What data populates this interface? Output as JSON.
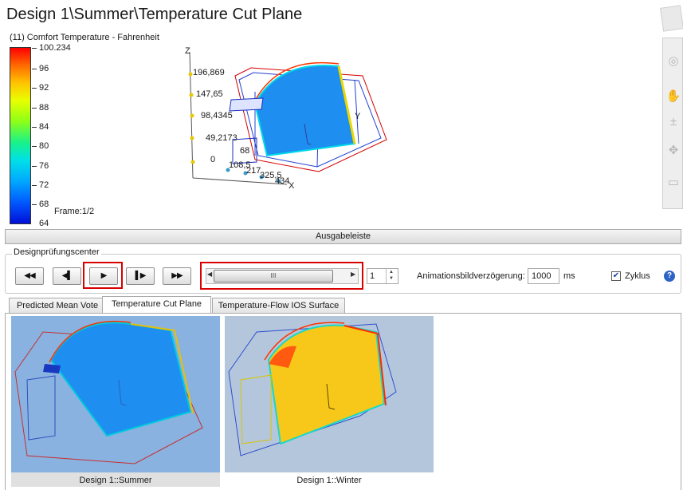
{
  "window": {
    "title": "Design 1\\Summer\\Temperature Cut Plane"
  },
  "legend": {
    "title": "(11) Comfort Temperature - Fahrenheit",
    "ticks": [
      "100.234",
      "96",
      "92",
      "88",
      "84",
      "80",
      "76",
      "72",
      "68",
      "64"
    ],
    "frame": "Frame:1/2"
  },
  "view3d": {
    "axis_z": "Z",
    "axis_y": "Y",
    "axis_x": "X",
    "z_ticks": [
      "196,869",
      "147,65",
      "98,4345",
      "49,2173",
      "0"
    ],
    "x_ticks": [
      "108,5",
      "217",
      "325,5",
      "434"
    ],
    "small_label": "68"
  },
  "output_bar": {
    "label": "Ausgabeleiste"
  },
  "design_center": {
    "label": "Designprüfungscenter",
    "buttons": {
      "first": "◀◀",
      "prev": "◀▌",
      "play": "▶",
      "next": "▌▶",
      "last": "▶▶"
    },
    "scroll_grip": "III",
    "frame_value": "1",
    "delay_label": "Animationsbildverzögerung:",
    "delay_value": "1000",
    "delay_unit": "ms",
    "cycle_label": "Zyklus",
    "cycle_checked": true,
    "help": "?"
  },
  "tabs": [
    {
      "label": "Predicted Mean Vote",
      "active": false
    },
    {
      "label": "Temperature Cut Plane",
      "active": true
    },
    {
      "label": "Temperature-Flow IOS Surface",
      "active": false
    }
  ],
  "gallery": [
    {
      "caption": "Design 1::Summer",
      "selected": true
    },
    {
      "caption": "Design 1::Winter",
      "selected": false
    }
  ],
  "icons": {
    "right_toolbar": [
      "orbit-icon",
      "pan-hand-icon",
      "zoom-icon",
      "rotate-icon",
      "view-cube-icon"
    ],
    "logo": "nightly-logo-icon"
  },
  "colors": {
    "highlight": "#d90000",
    "thumb_bg_summer": "#8ab2e0",
    "thumb_bg_winter": "#b4c6dc",
    "help_blue": "#2d62c6"
  }
}
